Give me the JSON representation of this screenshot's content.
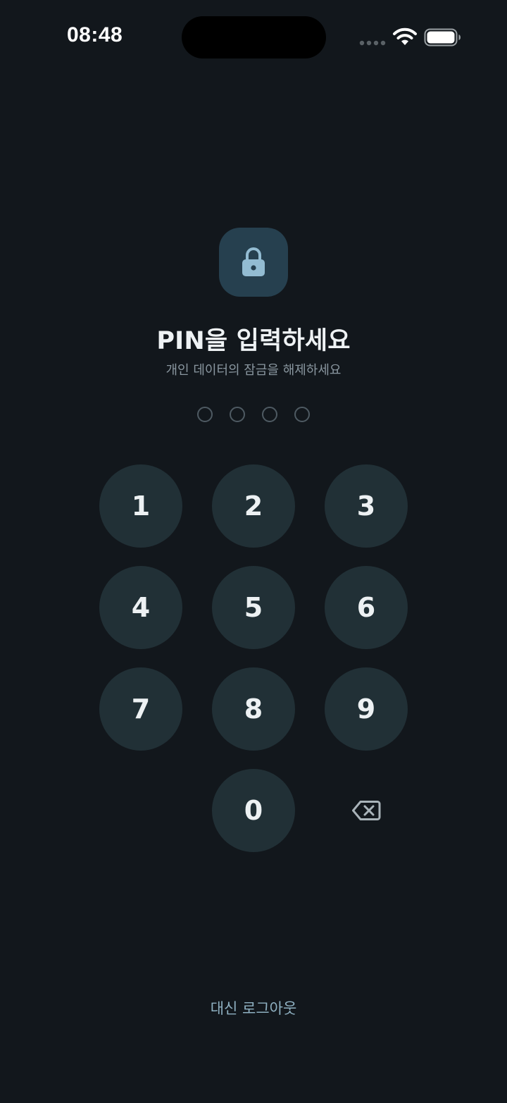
{
  "status_bar": {
    "time": "08:48"
  },
  "icons": {
    "lock": "lock-icon",
    "wifi": "wifi-icon",
    "battery": "battery-icon",
    "signal": "signal-icon",
    "backspace": "backspace-icon"
  },
  "header": {
    "title": "PIN을 입력하세요",
    "subtitle": "개인 데이터의 잠금을 해제하세요"
  },
  "pin": {
    "length": 4,
    "entered": 0
  },
  "keypad": {
    "keys": [
      "1",
      "2",
      "3",
      "4",
      "5",
      "6",
      "7",
      "8",
      "9",
      "0"
    ]
  },
  "footer": {
    "logout_label": "대신 로그아웃"
  },
  "colors": {
    "background": "#12171c",
    "key": "#213036",
    "lock_tile": "#26404f",
    "accent": "#8fb1c2"
  }
}
